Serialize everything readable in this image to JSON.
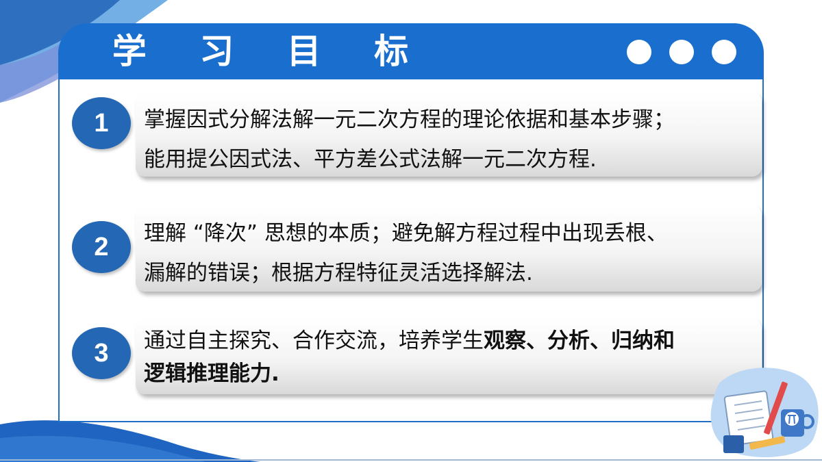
{
  "slide": {
    "title": "学 习 目 标",
    "accent_color": "#1a6fce",
    "badge_color": "#2467b4",
    "header_dots": [
      "dot",
      "dot",
      "dot"
    ]
  },
  "objectives": [
    {
      "number": "1",
      "line1": "掌握因式分解法解一元二次方程的理论依据和基本步骤；",
      "line2": "能用提公因式法、平方差公式法解一元二次方程."
    },
    {
      "number": "2",
      "line1": "理解 “降次” 思想的本质；避免解方程过程中出现丢根、",
      "line2": "漏解的错误；根据方程特征灵活选择解法."
    },
    {
      "number": "3",
      "line1_plain": "通过自主探究、合作交流，培养学生",
      "line1_bold": "观察、分析、归纳和",
      "line2_bold": "逻辑推理能力."
    }
  ],
  "decorations": {
    "corner_illustration": "math-study-icon"
  }
}
